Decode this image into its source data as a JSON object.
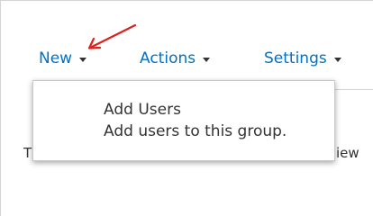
{
  "toolbar": {
    "new_label": "New",
    "actions_label": "Actions",
    "settings_label": "Settings"
  },
  "dropdown": {
    "item_title": "Add Users",
    "item_description": "Add users to this group."
  },
  "partially_hidden": {
    "left_text": "T",
    "right_text": "iew"
  },
  "colors": {
    "link_blue": "#0072c6",
    "annotation_red": "#e0201b",
    "text": "#333333"
  },
  "icons": {
    "caret": "chevron-down-icon",
    "annotation": "arrow-annotation-icon"
  }
}
